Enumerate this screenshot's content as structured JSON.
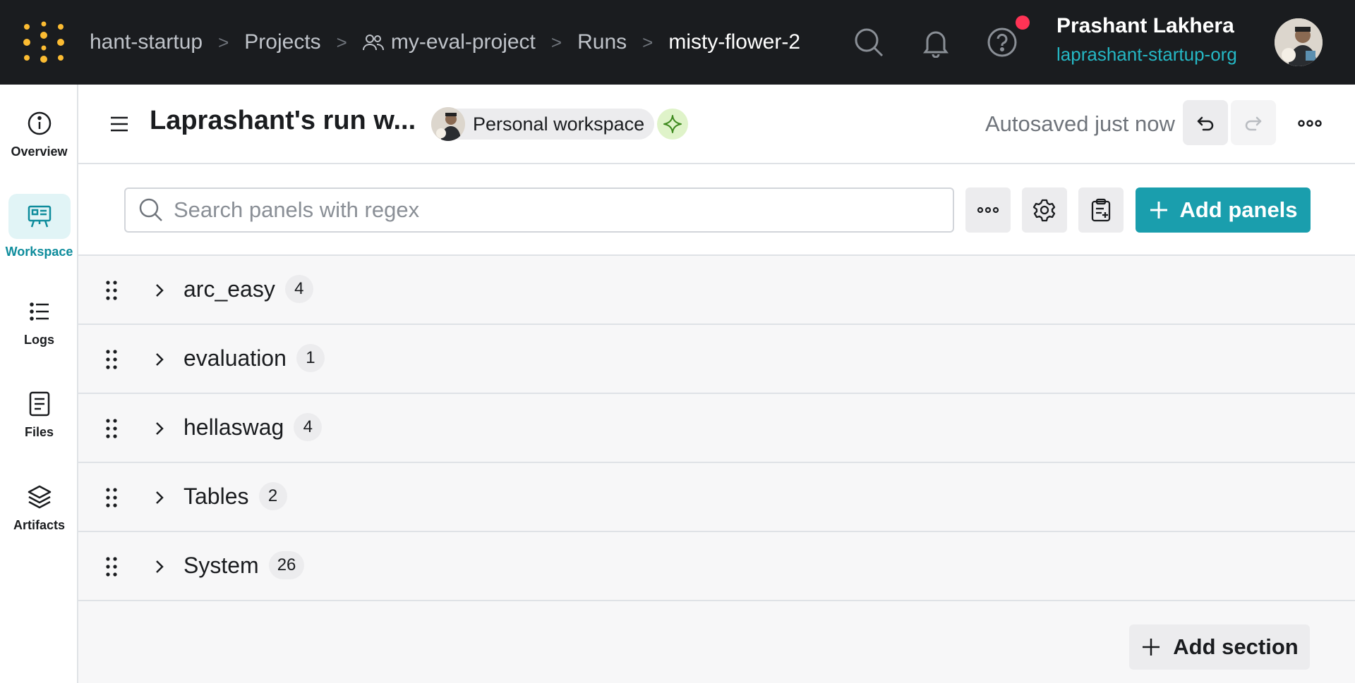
{
  "topbar": {
    "breadcrumb": {
      "org": "hant-startup",
      "projects": "Projects",
      "project": "my-eval-project",
      "runs": "Runs",
      "run": "misty-flower-2"
    },
    "icons": [
      "search-icon",
      "bell-icon",
      "help-icon"
    ],
    "user": {
      "name": "Prashant Lakhera",
      "org": "laprashant-startup-org"
    }
  },
  "sidebar": {
    "items": [
      {
        "label": "Overview",
        "icon": "info-icon",
        "active": false
      },
      {
        "label": "Workspace",
        "icon": "workspace-icon",
        "active": true
      },
      {
        "label": "Logs",
        "icon": "list-icon",
        "active": false
      },
      {
        "label": "Files",
        "icon": "file-icon",
        "active": false
      },
      {
        "label": "Artifacts",
        "icon": "layers-icon",
        "active": false
      }
    ]
  },
  "header": {
    "title": "Laprashant's run w...",
    "workspace_chip": "Personal workspace",
    "autosaved": "Autosaved just now"
  },
  "toolbar": {
    "search_placeholder": "Search panels with regex",
    "add_panels_label": "Add panels"
  },
  "sections": [
    {
      "name": "arc_easy",
      "count": "4"
    },
    {
      "name": "evaluation",
      "count": "1"
    },
    {
      "name": "hellaswag",
      "count": "4"
    },
    {
      "name": "Tables",
      "count": "2"
    },
    {
      "name": "System",
      "count": "26"
    }
  ],
  "add_section_label": "Add section",
  "colors": {
    "topbar_bg": "#1a1c1f",
    "accent": "#1a9ead",
    "org_link": "#25b7c4",
    "logo_gold": "#fcbc32",
    "notification": "#ff3355"
  }
}
